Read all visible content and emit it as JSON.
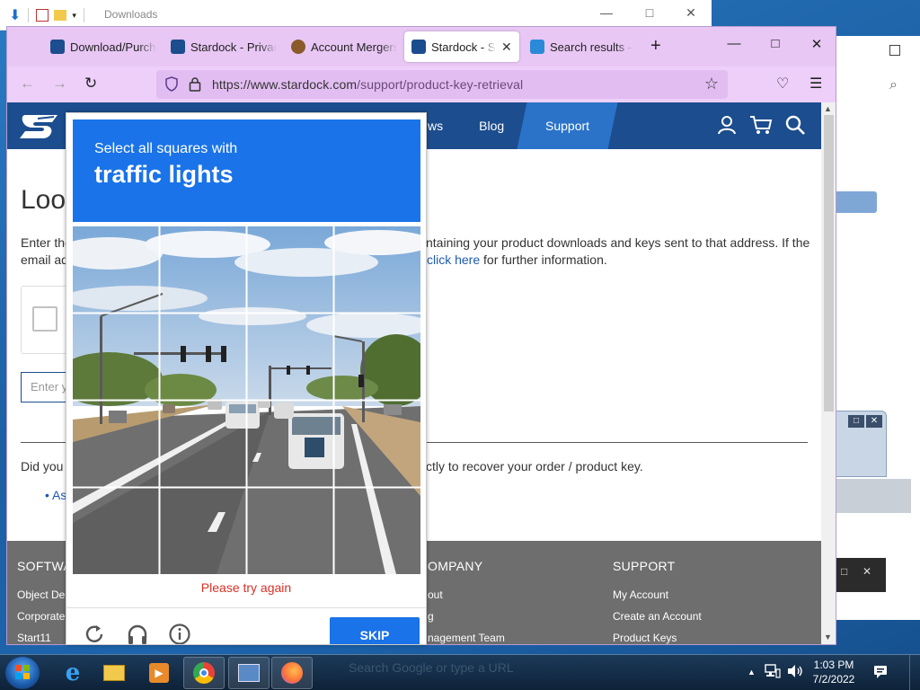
{
  "explorer": {
    "title": "Downloads"
  },
  "browser": {
    "tabs": [
      {
        "label": "Download/Purchase",
        "color": "#1c4d8e"
      },
      {
        "label": "Stardock - Privacy",
        "color": "#1c4d8e"
      },
      {
        "label": "Account Mergers",
        "color": "#8a5a2a"
      },
      {
        "label": "Stardock - Support",
        "color": "#1c4d8e",
        "active": true
      },
      {
        "label": "Search results – Avast",
        "color": "#2a8ad8"
      }
    ],
    "url_host": "https://www.stardock.com",
    "url_path": "/support/product-key-retrieval"
  },
  "site": {
    "nav": {
      "news": "ws",
      "blog": "Blog",
      "support": "Support"
    },
    "heading": "Loo",
    "para1_left": "Enter the",
    "para1_right": "ntaining your product downloads and keys sent to that address. If the",
    "para2_left": "email ad",
    "para2_link": "click here",
    "para2_right": " for further information.",
    "email_placeholder": "Enter y",
    "para3_left": "Did you",
    "para3_right": "ctly to recover your order / product key.",
    "bullet": "• As",
    "footer": {
      "col1_title": "SOFTWA",
      "col1_items": [
        "Object Des",
        "Corporate",
        "Start11"
      ],
      "col2_title": "OMPANY",
      "col2_items": [
        "out",
        "g",
        "nagement Team"
      ],
      "col3_title": "SUPPORT",
      "col3_items": [
        "My Account",
        "Create an Account",
        "Product Keys"
      ]
    }
  },
  "captcha": {
    "line1": "Select all squares with",
    "line2": "traffic lights",
    "error": "Please try again",
    "skip": "SKIP"
  },
  "taskbar": {
    "search_hint": "Search Google or type a URL",
    "time": "1:03 PM",
    "date": "7/2/2022"
  }
}
